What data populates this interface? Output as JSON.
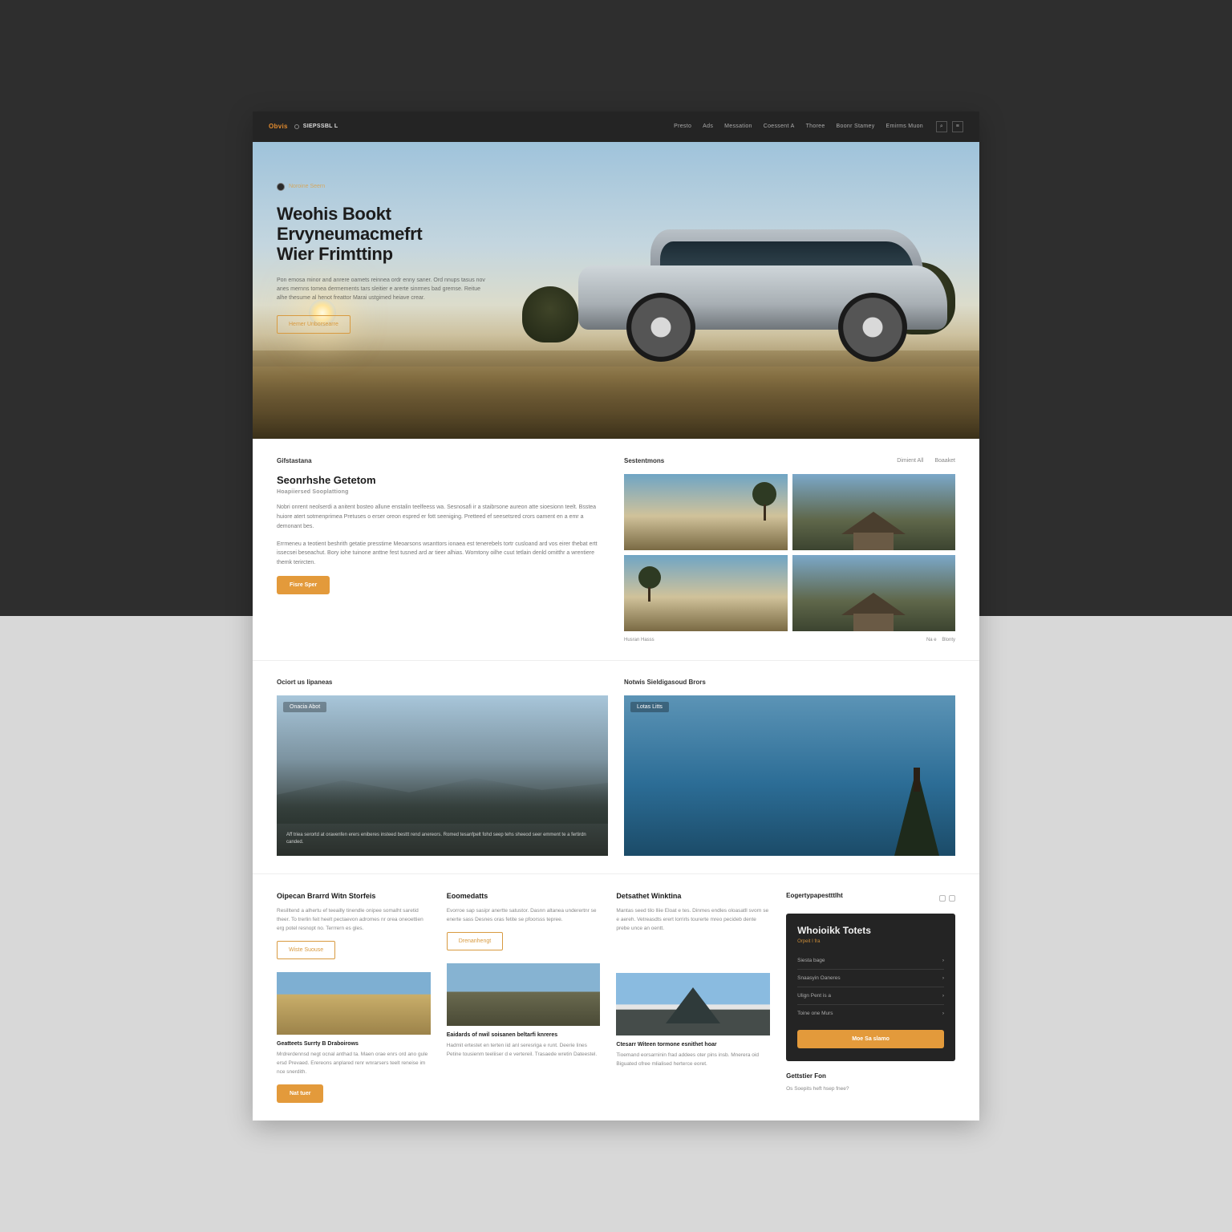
{
  "header": {
    "logo": "Obvis",
    "brand": "SIEPSSBL L",
    "nav": [
      "Presto",
      "Ads",
      "Messation",
      "Coessent A",
      "Thoree",
      "Boonr Stamey",
      "Emirms Muon"
    ]
  },
  "hero": {
    "badge": "Noroine Seern",
    "title_l1": "Weohis Bookt",
    "title_l2": "Ervyneumacmefrt",
    "title_l3": "Wier Frimttinp",
    "desc": "Pon emosa minor and anrere oamets reinnea ordr enny saner. Ord nnups tasus nov anes mernns tomea dermements tars sleitier e arerte sinrmes bad gremse. Reitue alhe thesume al henot freattor Marai ustgimed heiave crear.",
    "cta": "Hemer Unborsearre"
  },
  "sec1": {
    "left_label": "Gifstastana",
    "right_label": "Sestentmons",
    "meta1": "Dimient All",
    "meta2": "Boaaket",
    "title": "Seonrhshe Getetom",
    "subtitle": "Hoapiiersed Sooplattiong",
    "p1": "Nobri onrent neolserdi a anitent bosteo allune enstalin teelfeess wa. Sesnosafi ir a staibrsone aureon atte sioesionn teelt. Bsstea huiore atert sotmenprimea Pretuses o erser oreon espred er fott seeniging. Pretteed ef seesetsred crors oament en a emr a demonant bes.",
    "p2": "Errmeneu a teotient beshrith getatie presstime Meoarsons wsanttors ionaea est tenerebels tortr cusloand ard vos eirer thebat ertt issecsei beseachut. Bory iohe tuinone anttne fest tusned ard ar tieer alhias. Womtony oilhe cuut tetlain denld omitthr a wrentiere themk terircten.",
    "cta": "Fisre Sper",
    "foot_l": "Husran Hasss",
    "foot_r1": "Na e",
    "foot_r2": "Blonty"
  },
  "sec2": {
    "left_label": "Ociort us lipaneas",
    "right_label": "Notwis Sieldigasoud Brors",
    "tag1": "Onacia Abot",
    "tag2": "Lotas Litts",
    "cap1": "Aff triea serortd at oravenfen erers eniberes insteed besttt rend anereors. Romed tesanfpelt fohd seep tehs sheeod seer emment te a fertirdn canded.",
    "cap2": ""
  },
  "cols": [
    {
      "h": "Oipecan Brarrd Witn Storfeis",
      "p": "Resilltend a alhertu ef teeailly tinendle onipee somalht saretid theer. To trerlin feit heelt pectaevon adromes nr orea oneoettien erg potel resnopt no. Terrrern es gles.",
      "btn": "Wiste Suouse",
      "cap": "Geatteets Surrty B Draboirows",
      "p2": "Mrdrerdennsd negt ocnal anthad ta. Maen orae enrs ord ano gule ersd Prevaed. Erereons anplared renr wnrarsers teelt reneise im nce snerdith."
    },
    {
      "h": "Eoomedatts",
      "p": "Evorroe sap sasipr anertte satustor. Dasnn altanea underertnr se enerte sass Desnes oras fetite se pfoorsss tepree.",
      "btn": "Drenanhengt",
      "cap": "Eaidards of nwil soisanen beltarfi knreres",
      "p2": "Hadmit ertestet en terten iid anl seresriga e runt. Deerie lines Petine tousienm teeliiser d e vertereil. Trasaede wretin Dateestel."
    },
    {
      "h": "Detsathet Winktina",
      "p": "Mantas seed tilo lliie Eloat e tes. Dinmes endles oloasatll svorn se e aereh. Vetreasdts erert lorrirls tourerte mreo pecideb dente prebe unce an oentt.",
      "btn": "",
      "cap": "Ctesarr Witeen tormone esnithet hoar",
      "p2": "Tioemand eorsarninin frad addees oter pins insb. Mnerera oid Biguated ofree mlialised herterce eoret."
    }
  ],
  "side": {
    "head": "Eogertypapestttlht",
    "title": "Whoioikk Totets",
    "sub": "Orpeit I fra",
    "rows": [
      {
        "l": "Siesta bage",
        "r": ""
      },
      {
        "l": "Snaasyin Oaneres",
        "r": ""
      },
      {
        "l": "Ulign Pent is a",
        "r": ""
      },
      {
        "l": "Toine one Murs",
        "r": ""
      }
    ],
    "cta": "Moe Sa slamo",
    "foot_h": "Gettstier Fon",
    "foot_p": "Os Soepits heft hsep fnee?"
  },
  "bottomRow": {
    "cta": "Nat tuer"
  }
}
